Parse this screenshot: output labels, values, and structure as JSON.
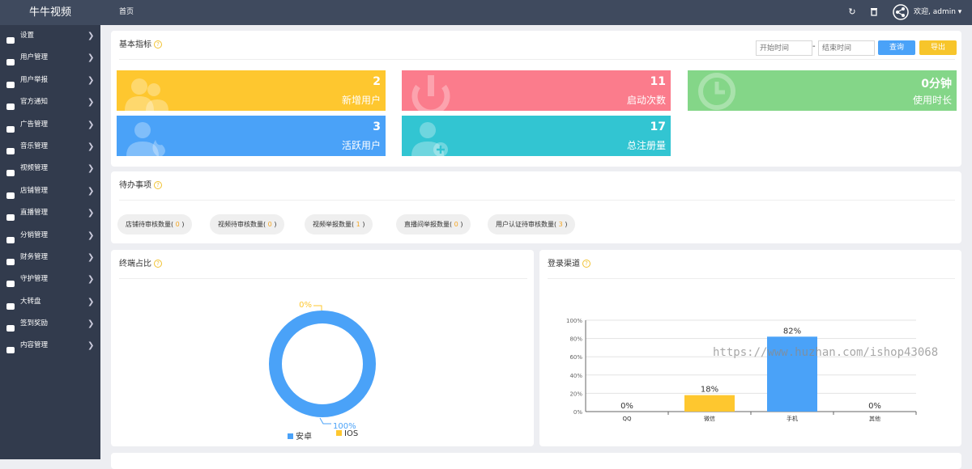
{
  "brand": "牛牛视频",
  "breadcrumb": "首页",
  "welcome": "欢迎, admin",
  "sidebar": {
    "items": [
      {
        "label": "设置",
        "icon": "gears-icon"
      },
      {
        "label": "用户管理",
        "icon": "users-icon"
      },
      {
        "label": "用户举报",
        "icon": "report-icon"
      },
      {
        "label": "官方通知",
        "icon": "bell-icon"
      },
      {
        "label": "广告管理",
        "icon": "eye-icon"
      },
      {
        "label": "音乐管理",
        "icon": "music-icon"
      },
      {
        "label": "视频管理",
        "icon": "video-file-icon"
      },
      {
        "label": "店铺管理",
        "icon": "cart-icon"
      },
      {
        "label": "直播管理",
        "icon": "monitor-icon"
      },
      {
        "label": "分销管理",
        "icon": "users-icon"
      },
      {
        "label": "财务管理",
        "icon": "yen-icon"
      },
      {
        "label": "守护管理",
        "icon": "shield-icon"
      },
      {
        "label": "大转盘",
        "icon": "gamepad-icon"
      },
      {
        "label": "签到奖励",
        "icon": "leaf-icon"
      },
      {
        "label": "内容管理",
        "icon": "monitor-icon"
      }
    ]
  },
  "metrics": {
    "title": "基本指标",
    "start_placeholder": "开始时间",
    "end_placeholder": "结束时间",
    "separator": "-",
    "query": "查询",
    "export": "导出",
    "cards": [
      {
        "value": "2",
        "label": "新增用户",
        "color": "#fec72f"
      },
      {
        "value": "11",
        "label": "启动次数",
        "color": "#fb7c8c"
      },
      {
        "value": "0分钟",
        "label": "使用时长",
        "color": "#84d688"
      },
      {
        "value": "3",
        "label": "活跃用户",
        "color": "#4aa2f8"
      },
      {
        "value": "17",
        "label": "总注册量",
        "color": "#32c5d2"
      }
    ]
  },
  "todo": {
    "title": "待办事项",
    "items": [
      {
        "label": "店铺待审核数量(",
        "count": "0",
        "close": ")"
      },
      {
        "label": "视频待审核数量(",
        "count": "0",
        "close": ")"
      },
      {
        "label": "视频举报数量(",
        "count": "1",
        "close": ")"
      },
      {
        "label": "直播间举报数量(",
        "count": "0",
        "close": ")"
      },
      {
        "label": "用户认证待审核数量(",
        "count": "3",
        "close": ")"
      }
    ]
  },
  "terminal": {
    "title": "终端占比"
  },
  "login": {
    "title": "登录渠道"
  },
  "watermark": "https://www.huzhan.com/ishop43068",
  "chart_data": [
    {
      "type": "pie",
      "title": "终端占比",
      "categories": [
        "安卓",
        "IOS"
      ],
      "values": [
        100,
        0
      ],
      "labels": [
        "100%",
        "0%"
      ],
      "colors": [
        "#4aa2f8",
        "#fec72f"
      ],
      "legend": "bottom"
    },
    {
      "type": "bar",
      "title": "登录渠道",
      "categories": [
        "QQ",
        "微信",
        "手机",
        "其他"
      ],
      "values": [
        0,
        18,
        82,
        0
      ],
      "labels": [
        "0%",
        "18%",
        "82%",
        "0%"
      ],
      "colors": [
        "#fec72f",
        "#fec72f",
        "#4aa2f8",
        "#fec72f"
      ],
      "ylim": [
        0,
        100
      ],
      "yticks": [
        "0%",
        "20%",
        "40%",
        "60%",
        "80%",
        "100%"
      ],
      "grid": true
    }
  ]
}
